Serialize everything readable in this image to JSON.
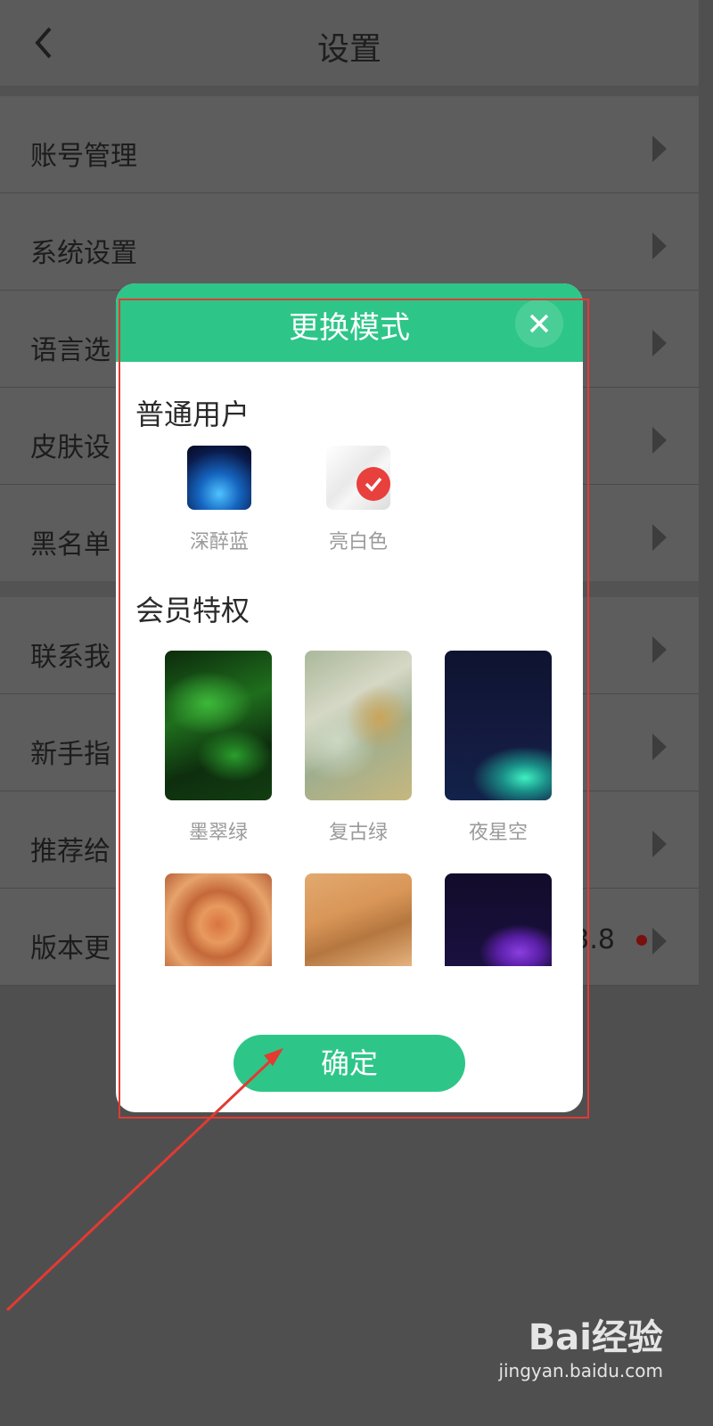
{
  "header": {
    "title": "设置"
  },
  "settings": {
    "items": [
      {
        "label": "账号管理"
      },
      {
        "label": "系统设置"
      },
      {
        "label": "语言选"
      },
      {
        "label": "皮肤设"
      },
      {
        "label": "黑名单"
      },
      {
        "label": "联系我"
      },
      {
        "label": "新手指"
      },
      {
        "label": "推荐给"
      },
      {
        "label": "版本更"
      }
    ],
    "version_value": "3.8"
  },
  "modal": {
    "title": "更换模式",
    "sections": [
      {
        "title": "普通用户",
        "items": [
          {
            "label": "深醉蓝",
            "selected": false
          },
          {
            "label": "亮白色",
            "selected": true
          }
        ]
      },
      {
        "title": "会员特权",
        "items": [
          {
            "label": "墨翠绿"
          },
          {
            "label": "复古绿"
          },
          {
            "label": "夜星空"
          },
          {
            "label": ""
          },
          {
            "label": ""
          },
          {
            "label": ""
          }
        ]
      }
    ],
    "confirm_label": "确定"
  },
  "watermark": {
    "brand": "Bai经验",
    "url": "jingyan.baidu.com"
  },
  "colors": {
    "accent": "#2dc688",
    "selected_badge": "#e8403c",
    "annotation": "#e33a32"
  }
}
